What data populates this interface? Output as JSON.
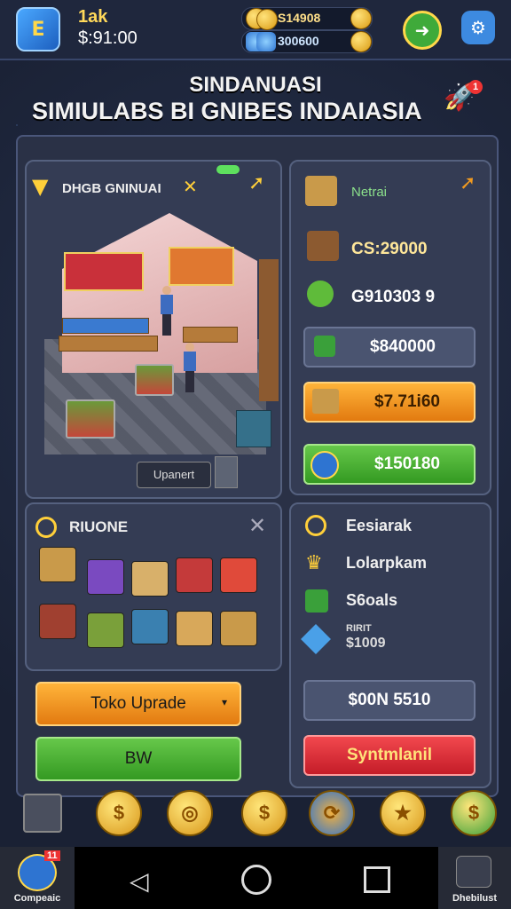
{
  "header": {
    "level": "1ak",
    "cash": "$:91:00",
    "gold": "S14908",
    "gems": "300600"
  },
  "title": {
    "line1": "SINDANUASI",
    "line2": "SIMIULABS BI GNIBES INDAIASIA",
    "badge": "1"
  },
  "store_panel": {
    "header": "DHGB GNINUAI",
    "upgrade_tag": "Upanert"
  },
  "side_panel": {
    "label": "Netrai",
    "stat1": "CS:29000",
    "stat2": "G910303 9",
    "btn_gray": "$840000",
    "btn_orange": "$7.71i60",
    "btn_green": "$150180"
  },
  "inventory": {
    "title": "RIUONE"
  },
  "stats2": {
    "row1": "Eesiarak",
    "row2": "Lolarpkam",
    "row3": "S6oals",
    "row4a": "RIRIT",
    "row4b": "$1009",
    "btn_gray": "$00N 5510",
    "btn_red": "Syntmlanil"
  },
  "buttons": {
    "upgrade": "Toko Uprade",
    "buy": "BW"
  },
  "dock_icons": [
    "chest-icon",
    "coin-icon",
    "coin-icon",
    "coin-icon",
    "coin-icon",
    "coin-icon",
    "dollar-coin-icon"
  ],
  "navbar": {
    "left_label": "Compeaic",
    "right_label": "Dhebilust",
    "badge": "11"
  },
  "colors": {
    "accent_gold": "#ffd95a",
    "green": "#4caf3a",
    "orange": "#f59b1a",
    "red": "#e0323c"
  }
}
